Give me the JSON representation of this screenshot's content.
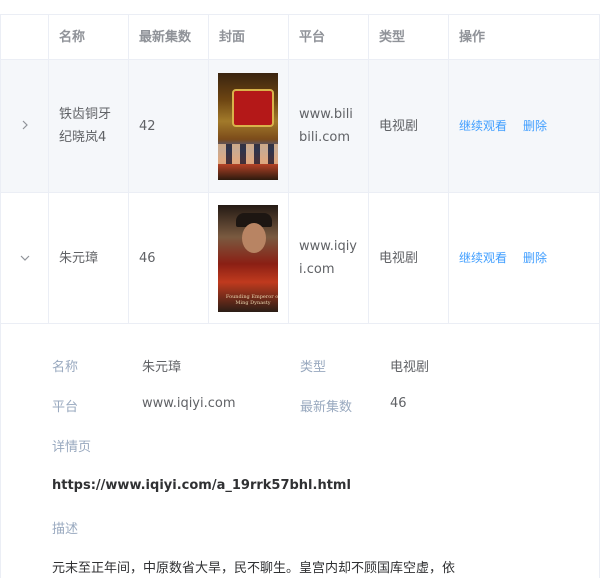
{
  "columns": [
    "名称",
    "最新集数",
    "封面",
    "平台",
    "类型",
    "操作"
  ],
  "rows": [
    {
      "expand_icon": "chevron-right-icon",
      "name": "铁齿铜牙纪晓岚4",
      "episodes": "42",
      "cover_icon": "poster-iron-teeth-icon",
      "platform": "www.bilibili.com",
      "type": "电视剧",
      "continue_label": "继续观看",
      "delete_label": "删除"
    },
    {
      "expand_icon": "chevron-down-icon",
      "name": "朱元璋",
      "episodes": "46",
      "cover_icon": "poster-zhu-yuanzhang-icon",
      "cover_caption": "Founding Emperor of Ming Dynasty",
      "platform": "www.iqiyi.com",
      "type": "电视剧",
      "continue_label": "继续观看",
      "delete_label": "删除"
    }
  ],
  "detail": {
    "name_label": "名称",
    "name_value": "朱元璋",
    "type_label": "类型",
    "type_value": "电视剧",
    "platform_label": "平台",
    "platform_value": "www.iqiyi.com",
    "episodes_label": "最新集数",
    "episodes_value": "46",
    "page_label": "详情页",
    "page_url": "https://www.iqiyi.com/a_19rrk57bhl.html",
    "desc_label": "描述",
    "desc_text": "元末至正年间，中原数省大旱，民不聊生。皇宫内却不顾国库空虚，依"
  },
  "colors": {
    "link": "#409eff",
    "label": "#99a9bf",
    "border": "#ebeef5",
    "hover_row": "#f5f7fa"
  }
}
